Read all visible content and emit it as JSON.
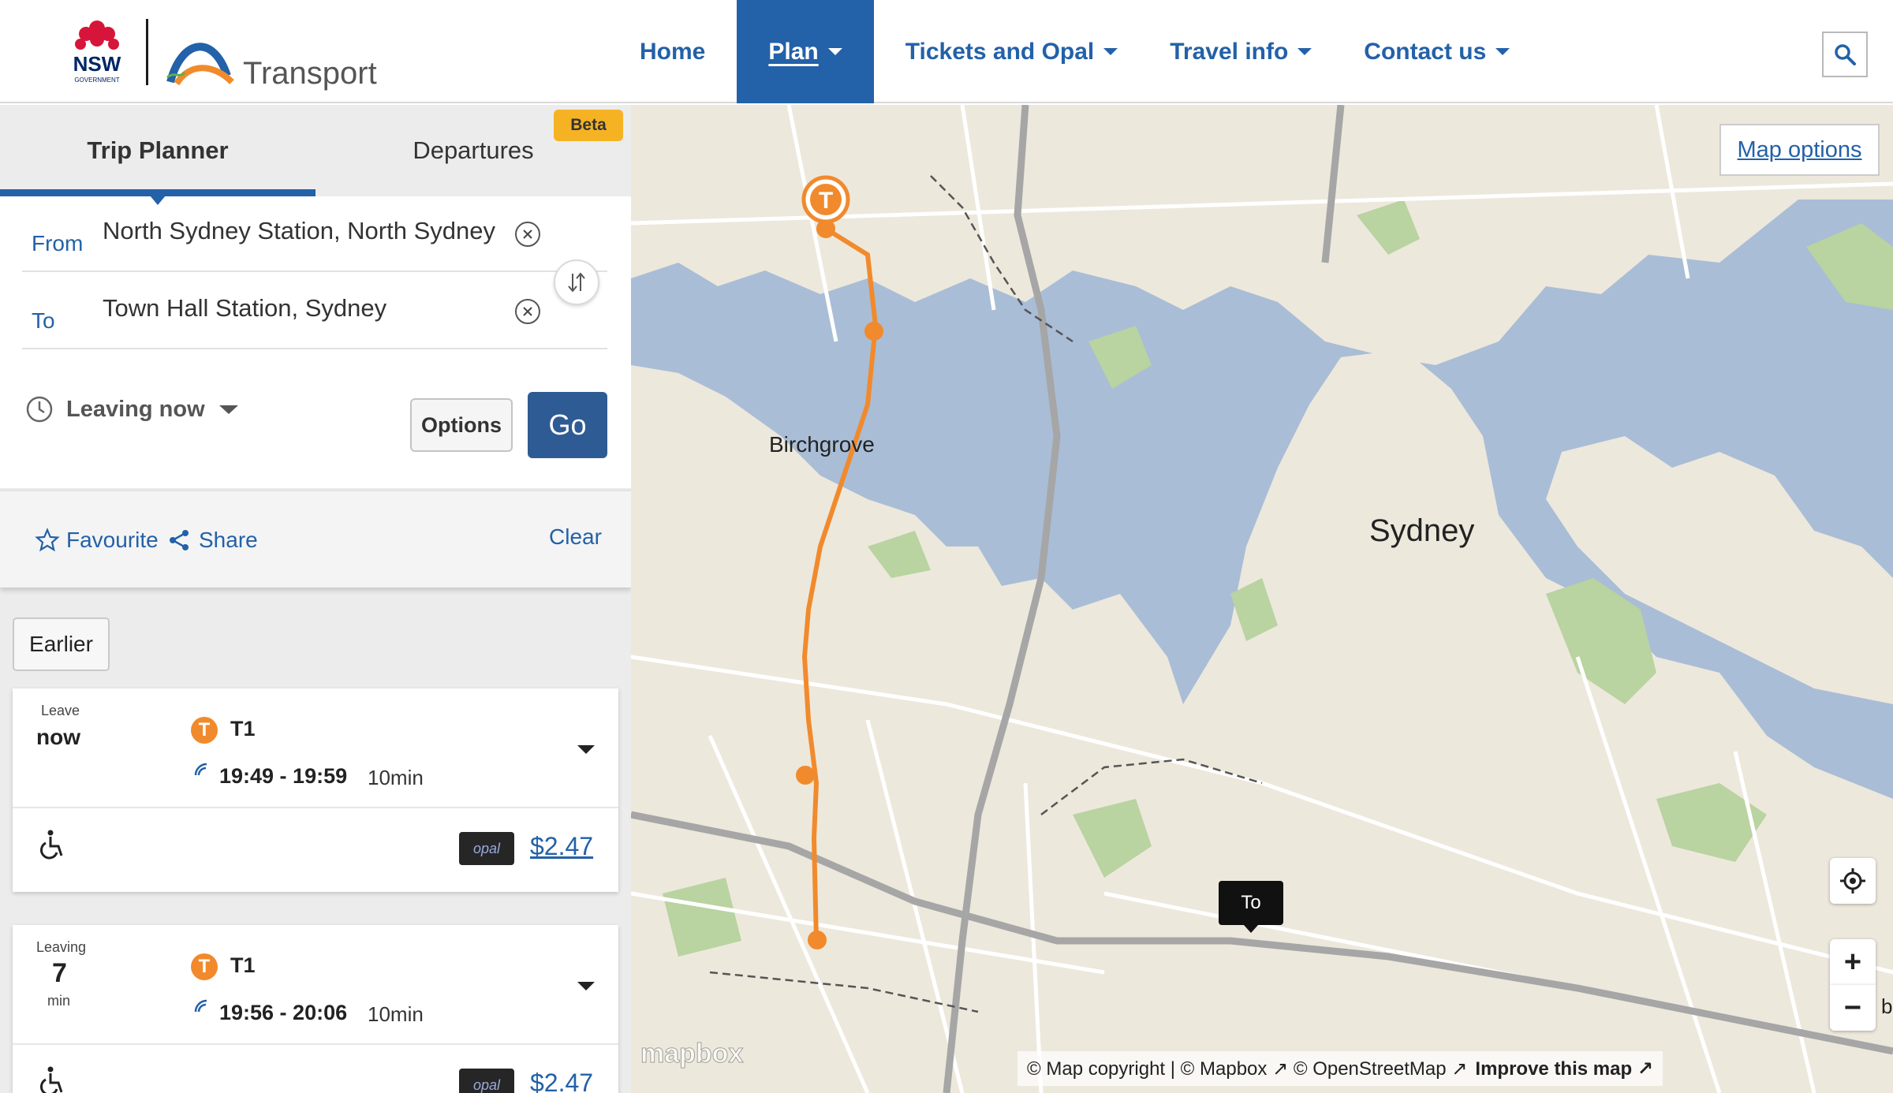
{
  "brand": {
    "nsw_text": "NSW",
    "nsw_sub": "GOVERNMENT",
    "transport_text": "Transport"
  },
  "nav": {
    "items": [
      {
        "label": "Home",
        "has_caret": false,
        "active": false
      },
      {
        "label": "Plan",
        "has_caret": true,
        "active": true
      },
      {
        "label": "Tickets and Opal",
        "has_caret": true,
        "active": false
      },
      {
        "label": "Travel info",
        "has_caret": true,
        "active": false
      },
      {
        "label": "Contact us",
        "has_caret": true,
        "active": false
      }
    ],
    "search_icon": "search-icon"
  },
  "planner": {
    "tabs": [
      {
        "label": "Trip Planner",
        "active": true
      },
      {
        "label": "Departures",
        "active": false
      }
    ],
    "beta_badge": "Beta",
    "from_label": "From",
    "from_value": "North Sydney Station, North Sydney",
    "to_label": "To",
    "to_value": "Town Hall Station, Sydney",
    "leaving_label": "Leaving now",
    "options_label": "Options",
    "go_label": "Go",
    "favourite_label": "Favourite",
    "share_label": "Share",
    "clear_label": "Clear",
    "earlier_label": "Earlier"
  },
  "trips": [
    {
      "leave_small": "Leave",
      "leave_main": "now",
      "leave_unit": "",
      "mode_badge": "T",
      "line": "T1",
      "times": "19:49 - 19:59",
      "duration": "10min",
      "opal_label": "opal",
      "fare": "$2.47"
    },
    {
      "leave_small": "Leaving",
      "leave_main": "7",
      "leave_unit": "min",
      "mode_badge": "T",
      "line": "T1",
      "times": "19:56 - 20:06",
      "duration": "10min",
      "opal_label": "opal",
      "fare": "$2.47"
    }
  ],
  "map": {
    "options_label": "Map options",
    "place_birchgrove": "Birchgrove",
    "place_sydney": "Sydney",
    "to_marker": "To",
    "origin_badge": "T",
    "zoom_in": "+",
    "zoom_out": "−",
    "mapbox_logo": "mapbox",
    "attribution": "© Map copyright | © Mapbox ↗ © OpenStreetMap ↗",
    "improve": "Improve this map ↗",
    "edge_text": "bl",
    "colors": {
      "water": "#a9bdd6",
      "land": "#ede8dc",
      "park": "#b9d3a1",
      "route": "#f18a2c",
      "accent": "#2361a8"
    }
  }
}
